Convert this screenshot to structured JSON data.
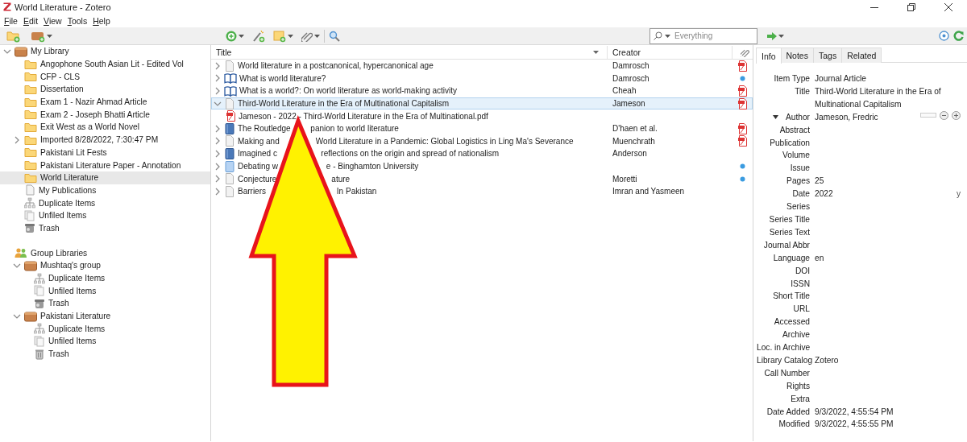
{
  "window": {
    "title": "World Literature - Zotero"
  },
  "menu": [
    {
      "label": "File"
    },
    {
      "label": "Edit"
    },
    {
      "label": "View"
    },
    {
      "label": "Tools"
    },
    {
      "label": "Help"
    }
  ],
  "search": {
    "placeholder": "Everything"
  },
  "collections": [
    {
      "label": "My Library",
      "kind": "library",
      "expanded": true,
      "selected": false,
      "children": [
        {
          "label": "Angophone South Asian Lit - Edited Vol",
          "kind": "folder",
          "selected": false
        },
        {
          "label": "CFP - CLS",
          "kind": "folder",
          "selected": false
        },
        {
          "label": "Dissertation",
          "kind": "folder",
          "selected": false
        },
        {
          "label": "Exam 1 - Nazir Ahmad Article",
          "kind": "folder",
          "selected": false
        },
        {
          "label": "Exam 2 - Joseph Bhatti Article",
          "kind": "folder",
          "selected": false
        },
        {
          "label": "Exit West as a World Novel",
          "kind": "folder",
          "selected": false
        },
        {
          "label": "Imported 8/28/2022, 7:30:47 PM",
          "kind": "folder",
          "expanded": false,
          "selected": false
        },
        {
          "label": "Pakistani Lit Fests",
          "kind": "folder",
          "selected": false
        },
        {
          "label": "Pakistani Literature Paper - Annotation",
          "kind": "folder",
          "selected": false
        },
        {
          "label": "World Literature",
          "kind": "folder",
          "selected": true
        },
        {
          "label": "My Publications",
          "kind": "publications",
          "selected": false
        },
        {
          "label": "Duplicate Items",
          "kind": "duplicates",
          "selected": false
        },
        {
          "label": "Unfiled Items",
          "kind": "unfiled",
          "selected": false
        },
        {
          "label": "Trash",
          "kind": "trash-full",
          "selected": false
        }
      ]
    },
    {
      "label": "Group Libraries",
      "kind": "groups",
      "selected": false,
      "children": [
        {
          "label": "Mushtaq's group",
          "kind": "library",
          "expanded": true,
          "selected": false,
          "children": [
            {
              "label": "Duplicate Items",
              "kind": "duplicates",
              "selected": false
            },
            {
              "label": "Unfiled Items",
              "kind": "unfiled",
              "selected": false
            },
            {
              "label": "Trash",
              "kind": "trash-full",
              "selected": false
            }
          ]
        },
        {
          "label": "Pakistani Literature",
          "kind": "library",
          "expanded": true,
          "selected": false,
          "children": [
            {
              "label": "Duplicate Items",
              "kind": "duplicates",
              "selected": false
            },
            {
              "label": "Unfiled Items",
              "kind": "unfiled",
              "selected": false
            },
            {
              "label": "Trash",
              "kind": "trash",
              "selected": false
            }
          ]
        }
      ]
    }
  ],
  "columns": [
    {
      "label": "Title",
      "sorted": true
    },
    {
      "label": "Creator",
      "sorted": false
    }
  ],
  "items": [
    {
      "kind": "document",
      "expanded": false,
      "selected": false,
      "title_parts": [
        "World literature in a postcanonical, hypercanonical age"
      ],
      "creator": "Damrosch",
      "attachment": {
        "kind": "pdf"
      }
    },
    {
      "kind": "book-section",
      "expanded": false,
      "selected": false,
      "title_parts": [
        "What is world literature?"
      ],
      "creator": "Damrosch",
      "attachment": {
        "kind": "dot"
      }
    },
    {
      "kind": "book-section",
      "expanded": false,
      "selected": false,
      "title_parts": [
        "What is a world?: On world literature as world-making activity"
      ],
      "creator": "Cheah",
      "attachment": {
        "kind": "pdf"
      }
    },
    {
      "kind": "document",
      "expanded": true,
      "selected": true,
      "title_parts": [
        "Third-World Literature in the Era of Multinational Capitalism"
      ],
      "creator": "Jameson",
      "attachment": {
        "kind": "pdf"
      },
      "children": [
        {
          "kind": "pdf",
          "selected": false,
          "title_parts": [
            "Jameson - 2022 - Third-World Literature in the Era of Multinational.pdf"
          ]
        }
      ]
    },
    {
      "kind": "book",
      "expanded": false,
      "selected": false,
      "title_parts": [
        "The Routledge",
        "panion to world literature"
      ],
      "creator": "D'haen et al.",
      "attachment": {
        "kind": "pdf"
      }
    },
    {
      "kind": "document",
      "expanded": false,
      "selected": false,
      "title_parts": [
        "Making and",
        "World Literature in a Pandemic: Global Logistics in Ling Ma's Severance"
      ],
      "creator": "Muenchrath",
      "attachment": {
        "kind": "pdf"
      }
    },
    {
      "kind": "book",
      "expanded": false,
      "selected": false,
      "title_parts": [
        "Imagined c",
        "reflections on the origin and spread of nationalism"
      ],
      "creator": "Anderson"
    },
    {
      "kind": "light-book",
      "expanded": false,
      "selected": false,
      "title_parts": [
        "Debating w",
        "e - Binghamton University"
      ],
      "attachment": {
        "kind": "dot"
      }
    },
    {
      "kind": "document",
      "expanded": false,
      "selected": false,
      "title_parts": [
        "Conjecture",
        "ature"
      ],
      "creator": "Moretti",
      "attachment": {
        "kind": "dot"
      }
    },
    {
      "kind": "document",
      "expanded": false,
      "selected": false,
      "title_parts": [
        "Barriers",
        "In Pakistan"
      ],
      "creator": "Imran and Yasmeen"
    }
  ],
  "tabs": [
    {
      "label": "Info",
      "selected": true
    },
    {
      "label": "Notes",
      "selected": false
    },
    {
      "label": "Tags",
      "selected": false
    },
    {
      "label": "Related",
      "selected": false
    }
  ],
  "fields": [
    {
      "label": "Item Type",
      "value": "Journal Article"
    },
    {
      "label": "Title",
      "value": "Third-World Literature in the Era of Multinational Capitalism"
    },
    {
      "label": "Author",
      "value": "Jameson, Fredric",
      "kind": "creator"
    },
    {
      "label": "Abstract"
    },
    {
      "label": "Publication"
    },
    {
      "label": "Volume"
    },
    {
      "label": "Issue"
    },
    {
      "label": "Pages",
      "value": "25"
    },
    {
      "label": "Date",
      "value": "2022",
      "flag": "y"
    },
    {
      "label": "Series"
    },
    {
      "label": "Series Title"
    },
    {
      "label": "Series Text"
    },
    {
      "label": "Journal Abbr"
    },
    {
      "label": "Language",
      "value": "en"
    },
    {
      "label": "DOI"
    },
    {
      "label": "ISSN"
    },
    {
      "label": "Short Title"
    },
    {
      "label": "URL"
    },
    {
      "label": "Accessed"
    },
    {
      "label": "Archive"
    },
    {
      "label": "Loc. in Archive"
    },
    {
      "label": "Library Catalog",
      "value": "Zotero"
    },
    {
      "label": "Call Number"
    },
    {
      "label": "Rights"
    },
    {
      "label": "Extra"
    },
    {
      "label": "Date Added",
      "value": "9/3/2022, 4:55:54 PM"
    },
    {
      "label": "Modified",
      "value": "9/3/2022, 4:55:55 PM"
    }
  ],
  "annotation": {
    "kind": "arrow"
  }
}
